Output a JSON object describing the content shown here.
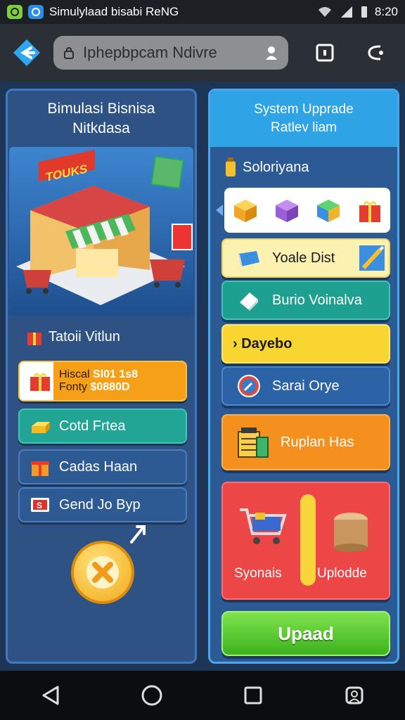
{
  "status_bar": {
    "title": "Simulylaad bisabi ReNG",
    "time": "8:20",
    "icons": [
      "app-icon",
      "browser-app-icon",
      "wifi-icon",
      "signal-icon",
      "battery-icon"
    ]
  },
  "browser": {
    "url": "Iphepbpcam Ndivre",
    "icons": [
      "back-arrow-icon",
      "lock-icon",
      "person-icon",
      "tabs-icon",
      "share-icon"
    ]
  },
  "left_panel": {
    "title_line1": "Bimulasi Bisnisa",
    "title_line2": "Nitkdasa",
    "sign_text": "TOUKS",
    "subtitle": "Tatoii Vitlun",
    "stats": {
      "line1_label": "Hiscal",
      "line1_value": "Sl01 1s8",
      "line2_label": "Fonty",
      "line2_value": "$0880D"
    },
    "buttons": [
      {
        "label": "Cotd Frtea",
        "icon": "gold-bars-icon"
      },
      {
        "label": "Cadas Haan",
        "icon": "gift-icon"
      },
      {
        "label": "Gend Jo Byp",
        "icon": "cash-icon"
      }
    ],
    "badge_text": "S",
    "close_icon": "close-icon"
  },
  "right_panel": {
    "header_line1": "System Upprade",
    "header_line2": "Ratlev liam",
    "subtitle": "Soloriyana",
    "tray_items": [
      "box-icon",
      "purple-box-icon",
      "cube-icon",
      "gift-icon"
    ],
    "buttons": [
      {
        "label": "Yoale Dist",
        "icon": "book-icon"
      },
      {
        "label": "Burio Voinalva",
        "icon": "paper-icon"
      },
      {
        "label": "› Dayebo",
        "icon": ""
      },
      {
        "label": "Sarai Orye",
        "icon": "compass-icon"
      },
      {
        "label": "Ruplan Has",
        "icon": "register-icon"
      }
    ],
    "upgrade_card": {
      "left_label": "Syonais",
      "right_label": "Uplodde"
    },
    "upgrade_button": "Upaad"
  },
  "colors": {
    "accent_green": "#3cb31d",
    "panel_blue": "#2b5a95",
    "orange": "#f58f1e",
    "red": "#ec4646",
    "teal": "#1da08f",
    "yellow": "#f9d531"
  }
}
